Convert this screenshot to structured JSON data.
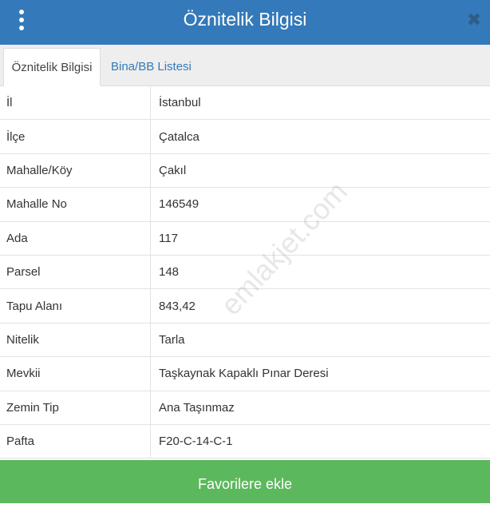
{
  "header": {
    "title": "Öznitelik Bilgisi",
    "menu_icon": "kebab-menu-icon",
    "close_icon": "close-icon",
    "close_glyph": "✖",
    "colors": {
      "bar": "#3479b9",
      "close": "#2f5d85"
    }
  },
  "tabs": [
    {
      "label": "Öznitelik Bilgisi",
      "active": true
    },
    {
      "label": "Bina/BB Listesi",
      "active": false
    }
  ],
  "attributes": [
    {
      "key": "İl",
      "value": "İstanbul"
    },
    {
      "key": "İlçe",
      "value": "Çatalca"
    },
    {
      "key": "Mahalle/Köy",
      "value": "Çakıl"
    },
    {
      "key": "Mahalle No",
      "value": "146549"
    },
    {
      "key": "Ada",
      "value": "117"
    },
    {
      "key": "Parsel",
      "value": "148"
    },
    {
      "key": "Tapu Alanı",
      "value": "843,42"
    },
    {
      "key": "Nitelik",
      "value": "Tarla"
    },
    {
      "key": "Mevkii",
      "value": "Taşkaynak Kapaklı Pınar Deresi"
    },
    {
      "key": "Zemin Tip",
      "value": "Ana Taşınmaz"
    },
    {
      "key": "Pafta",
      "value": "F20-C-14-C-1"
    }
  ],
  "favorite_button": {
    "label": "Favorilere ekle",
    "color": "#5cb85c"
  },
  "watermark": "emlakjet.com"
}
